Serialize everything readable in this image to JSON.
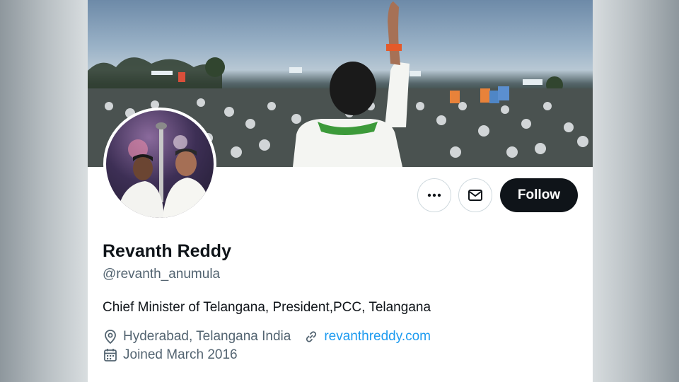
{
  "profile": {
    "name": "Revanth Reddy",
    "handle": "@revanth_anumula",
    "bio": "Chief Minister of Telangana, President,PCC, Telangana",
    "location": "Hyderabad, Telangana India",
    "website": "revanthreddy.com",
    "joined": "Joined March 2016"
  },
  "actions": {
    "more_icon": "more-horizontal-icon",
    "message_icon": "mail-icon",
    "follow_label": "Follow"
  },
  "icons": {
    "location": "location-pin-icon",
    "link": "link-icon",
    "calendar": "calendar-icon"
  },
  "colors": {
    "text_primary": "#0f1419",
    "text_secondary": "#536471",
    "link": "#1d9bf0",
    "follow_bg": "#0f1419"
  }
}
